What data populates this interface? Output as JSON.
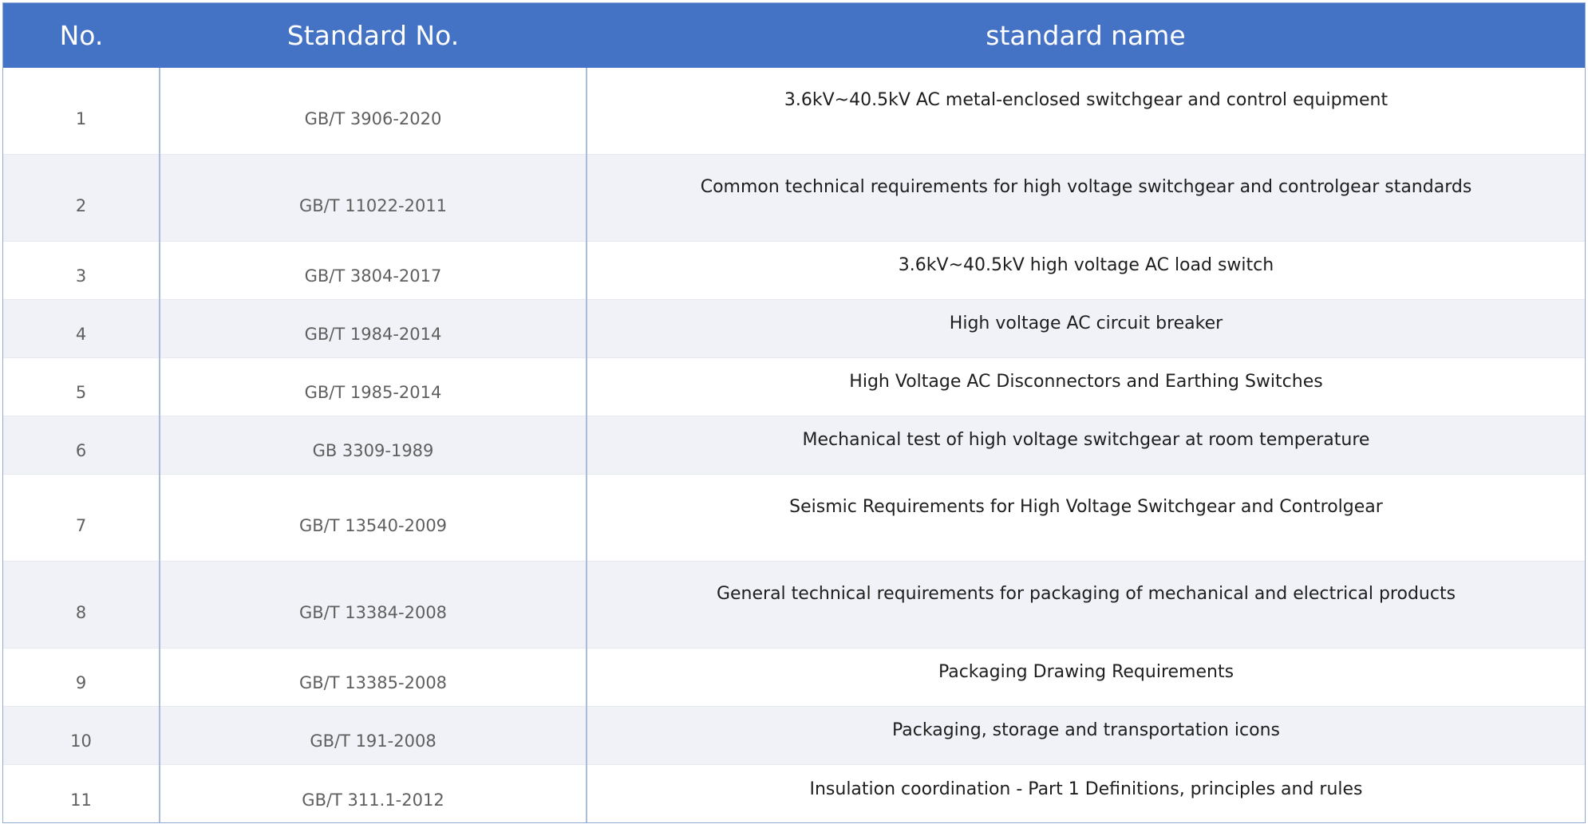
{
  "table": {
    "headers": {
      "no": "No.",
      "code": "Standard No.",
      "name": "standard name"
    },
    "rows": [
      {
        "no": "1",
        "code": "GB/T 3906-2020",
        "name": "3.6kV~40.5kV AC metal-enclosed switchgear and control equipment"
      },
      {
        "no": "2",
        "code": "GB/T 11022-2011",
        "name": "Common technical requirements for high voltage switchgear and controlgear standards"
      },
      {
        "no": "3",
        "code": "GB/T 3804-2017",
        "name": "3.6kV~40.5kV high voltage AC load switch"
      },
      {
        "no": "4",
        "code": "GB/T 1984-2014",
        "name": "High voltage AC circuit breaker"
      },
      {
        "no": "5",
        "code": "GB/T 1985-2014",
        "name": "High Voltage AC Disconnectors and Earthing Switches"
      },
      {
        "no": "6",
        "code": "GB 3309-1989",
        "name": "Mechanical test of high voltage switchgear at room temperature"
      },
      {
        "no": "7",
        "code": "GB/T 13540-2009",
        "name": "Seismic Requirements for High Voltage Switchgear and Controlgear"
      },
      {
        "no": "8",
        "code": "GB/T 13384-2008",
        "name": "General technical requirements for packaging of mechanical and electrical products"
      },
      {
        "no": "9",
        "code": "GB/T 13385-2008",
        "name": "Packaging Drawing Requirements"
      },
      {
        "no": "10",
        "code": "GB/T 191-2008",
        "name": "Packaging, storage and transportation icons"
      },
      {
        "no": "11",
        "code": "GB/T 311.1-2012",
        "name": "Insulation coordination - Part 1 Definitions, principles and rules"
      }
    ]
  }
}
